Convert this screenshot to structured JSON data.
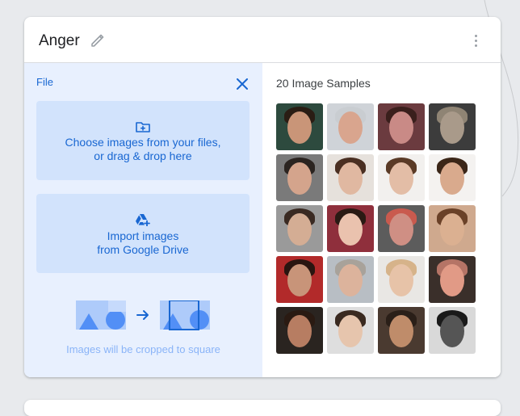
{
  "card": {
    "class_name": "Anger"
  },
  "upload_panel": {
    "file_label": "File",
    "choose_line1": "Choose images from your files,",
    "choose_line2": "or drag & drop here",
    "drive_line1": "Import images",
    "drive_line2": "from Google Drive",
    "crop_note": "Images will be cropped to square"
  },
  "samples": {
    "title": "20 Image Samples",
    "thumbnails": [
      {
        "bg": "#2d4a3e",
        "skin": "#c99578",
        "hair": "#2a1d14"
      },
      {
        "bg": "#cfd3d8",
        "skin": "#d9a58e",
        "hair": "#c9cdd1"
      },
      {
        "bg": "#6b3b3f",
        "skin": "#c98a86",
        "hair": "#3a1f1c"
      },
      {
        "bg": "#3c3c3c",
        "skin": "#a99a8a",
        "hair": "#8f8474"
      },
      {
        "bg": "#7a7a7a",
        "skin": "#d4a48c",
        "hair": "#2b2420"
      },
      {
        "bg": "#e6e1dc",
        "skin": "#e0b8a1",
        "hair": "#4a2f22"
      },
      {
        "bg": "#f2f0ee",
        "skin": "#e3bda6",
        "hair": "#5a3a26"
      },
      {
        "bg": "#f4f2f0",
        "skin": "#d9aa8d",
        "hair": "#3b2618"
      },
      {
        "bg": "#9a9a9a",
        "skin": "#d4ad94",
        "hair": "#3a2a22"
      },
      {
        "bg": "#8f2f3c",
        "skin": "#eac2ae",
        "hair": "#2a1a14"
      },
      {
        "bg": "#5c5c5c",
        "skin": "#cf8f84",
        "hair": "#c95a4e"
      },
      {
        "bg": "#cfa98e",
        "skin": "#dbb091",
        "hair": "#6a4128"
      },
      {
        "bg": "#b22a2a",
        "skin": "#c89479",
        "hair": "#2a1510"
      },
      {
        "bg": "#b8bec4",
        "skin": "#dcb39c",
        "hair": "#a8a29a"
      },
      {
        "bg": "#e9e7e4",
        "skin": "#e7c3a8",
        "hair": "#d6b38a"
      },
      {
        "bg": "#3a2f2a",
        "skin": "#e19a86",
        "hair": "#b57466"
      },
      {
        "bg": "#2a2420",
        "skin": "#b77d62",
        "hair": "#2a1a12"
      },
      {
        "bg": "#dedede",
        "skin": "#e6c5ad",
        "hair": "#3a2a20"
      },
      {
        "bg": "#4a3a30",
        "skin": "#bf8c6a",
        "hair": "#2a1f18"
      },
      {
        "bg": "#d9d9d9",
        "skin": "#555555",
        "hair": "#1a1a1a"
      }
    ]
  },
  "icons": {
    "edit": "pencil-icon",
    "more": "more-vert-icon",
    "close": "close-icon",
    "upload": "folder-add-icon",
    "drive": "google-drive-add-icon"
  },
  "colors": {
    "accent": "#1967d2",
    "panel_bg": "#e8f0fe",
    "action_bg": "#d2e3fc",
    "page_bg": "#e8eaed"
  }
}
